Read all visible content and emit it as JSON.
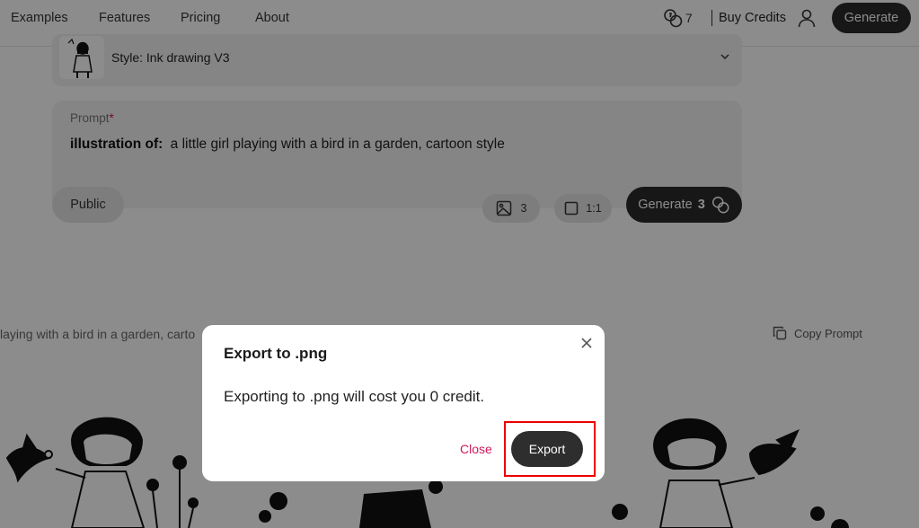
{
  "nav": {
    "links": [
      "Examples",
      "Features",
      "Pricing",
      "About"
    ],
    "credits": "7",
    "buy_credits": "Buy Credits",
    "generate": "Generate"
  },
  "style": {
    "label": "Style: Ink drawing V3"
  },
  "prompt": {
    "header": "Prompt",
    "required_mark": "*",
    "prefix": "illustration of:",
    "text": "a little girl playing with a bird in a garden, cartoon style"
  },
  "controls": {
    "visibility": "Public",
    "image_count": "3",
    "aspect_ratio": "1:1",
    "generate_label": "Generate",
    "generate_cost": "3"
  },
  "result": {
    "prompt_snippet": "laying with a bird in a garden, carto",
    "copy_prompt": "Copy Prompt"
  },
  "modal": {
    "title": "Export to .png",
    "body": "Exporting to .png will cost you 0 credit.",
    "close_label": "Close",
    "export_label": "Export"
  },
  "colors": {
    "accent_dark": "#2b2b2b",
    "close_link": "#d0185c",
    "highlight": "#e00000"
  }
}
